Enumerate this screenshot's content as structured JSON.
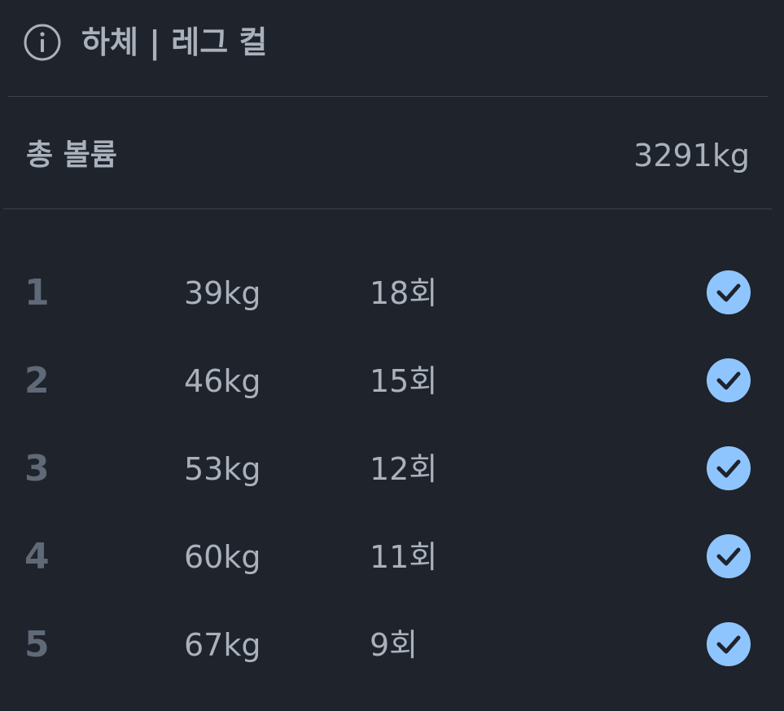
{
  "header": {
    "icon": "info-icon",
    "title": "하체 | 레그 컬"
  },
  "summary": {
    "label": "총 볼륨",
    "value": "3291kg"
  },
  "sets": [
    {
      "number": "1",
      "weight": "39kg",
      "reps": "18회",
      "completed": true
    },
    {
      "number": "2",
      "weight": "46kg",
      "reps": "15회",
      "completed": true
    },
    {
      "number": "3",
      "weight": "53kg",
      "reps": "12회",
      "completed": true
    },
    {
      "number": "4",
      "weight": "60kg",
      "reps": "11회",
      "completed": true
    },
    {
      "number": "5",
      "weight": "67kg",
      "reps": "9회",
      "completed": true
    }
  ],
  "colors": {
    "background": "#1f232b",
    "text": "#a9b1bc",
    "set_number": "#5f6977",
    "divider": "#3c424c",
    "check_fill": "#8ec5ff",
    "check_mark": "#1f232b"
  }
}
